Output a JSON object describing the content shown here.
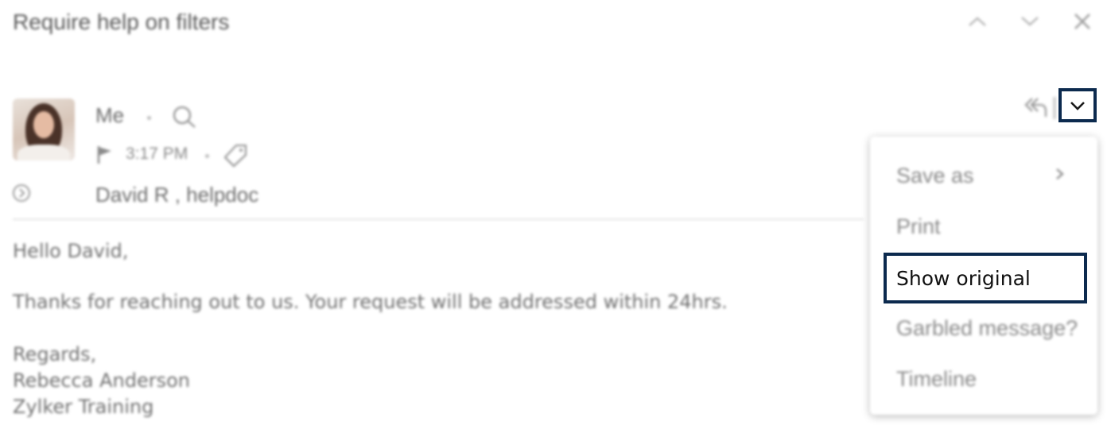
{
  "email": {
    "subject": "Require help on filters",
    "sender": "Me",
    "time": "3:17 PM",
    "recipients": "David R , helpdoc",
    "body": {
      "greeting": "Hello David,",
      "message": "Thanks for reaching out to us. Your request will be addressed within 24hrs.",
      "signoff": "Regards,",
      "name": "Rebecca Anderson",
      "company": "Zylker Training"
    }
  },
  "menu": {
    "items": [
      {
        "label": "Save as"
      },
      {
        "label": "Print"
      },
      {
        "label": "Show original"
      },
      {
        "label": "Garbled message?"
      },
      {
        "label": "Timeline"
      }
    ]
  },
  "colors": {
    "highlight_border": "#0c2a4e",
    "muted_text": "#6d6d6d"
  },
  "icons": {
    "top_actions": [
      "chevron-up-icon",
      "chevron-down-icon",
      "close-icon"
    ],
    "sender_actions": [
      "search-icon",
      "flag-icon",
      "tag-icon",
      "expand-icon",
      "reply-all-icon",
      "dropdown-chevron-icon"
    ]
  }
}
